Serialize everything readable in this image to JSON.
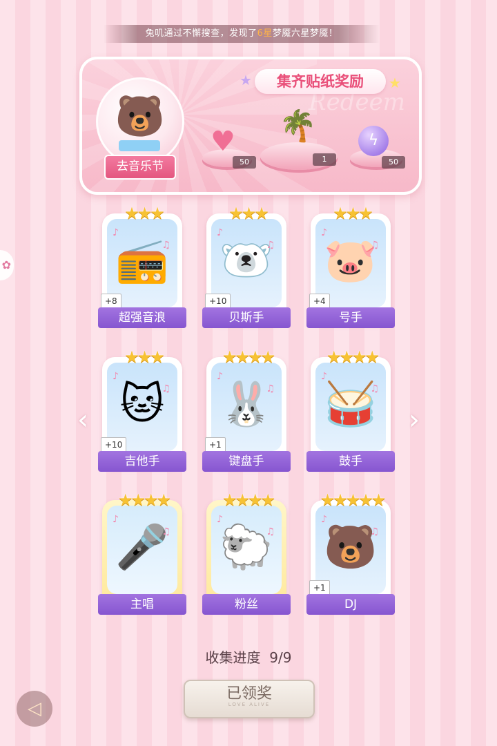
{
  "ticker": {
    "prefix": "兔叽通过不懈搜查，发现了",
    "highlight": "6星",
    "suffix": "梦魇六星梦魇！"
  },
  "banner": {
    "title": "集齐贴纸奖励",
    "watermark": "Redeem",
    "go_button": "去音乐节",
    "rewards": [
      {
        "icon": "pink-heart-gem-icon",
        "qty": "50"
      },
      {
        "icon": "palm-island-icon",
        "qty": "1"
      },
      {
        "icon": "purple-orb-icon",
        "qty": "50"
      }
    ]
  },
  "cards": [
    {
      "name": "超强音浪",
      "stars": "★★★",
      "bonus": "+8",
      "icon": "boombox-icon",
      "emoji": "📻",
      "gold": false
    },
    {
      "name": "贝斯手",
      "stars": "★★★",
      "bonus": "+10",
      "icon": "bear-bassist-icon",
      "emoji": "🐻‍❄️",
      "gold": false
    },
    {
      "name": "号手",
      "stars": "★★★",
      "bonus": "+4",
      "icon": "pig-saxophone-icon",
      "emoji": "🐷",
      "gold": false
    },
    {
      "name": "吉他手",
      "stars": "★★★",
      "bonus": "+10",
      "icon": "cat-guitarist-icon",
      "emoji": "🐱",
      "gold": false
    },
    {
      "name": "键盘手",
      "stars": "★★★★",
      "bonus": "+1",
      "icon": "bunny-keyboard-icon",
      "emoji": "🐰",
      "gold": false
    },
    {
      "name": "鼓手",
      "stars": "★★★★",
      "bonus": "",
      "icon": "dog-drummer-icon",
      "emoji": "🥁",
      "gold": false
    },
    {
      "name": "主唱",
      "stars": "★★★★",
      "bonus": "",
      "icon": "singer-boy-icon",
      "emoji": "🎤",
      "gold": true
    },
    {
      "name": "粉丝",
      "stars": "★★★★",
      "bonus": "",
      "icon": "sheep-fan-icon",
      "emoji": "🐑",
      "gold": true
    },
    {
      "name": "DJ",
      "stars": "★★★★★",
      "bonus": "+1",
      "icon": "bear-dj-icon",
      "emoji": "🐻",
      "gold": false
    }
  ],
  "progress": {
    "label": "收集进度",
    "value": "9/9"
  },
  "claim": {
    "label": "已领奖",
    "sub": "LOVE ALIVE"
  },
  "nav": {
    "prev": "‹",
    "next": "›",
    "back": "◁"
  }
}
